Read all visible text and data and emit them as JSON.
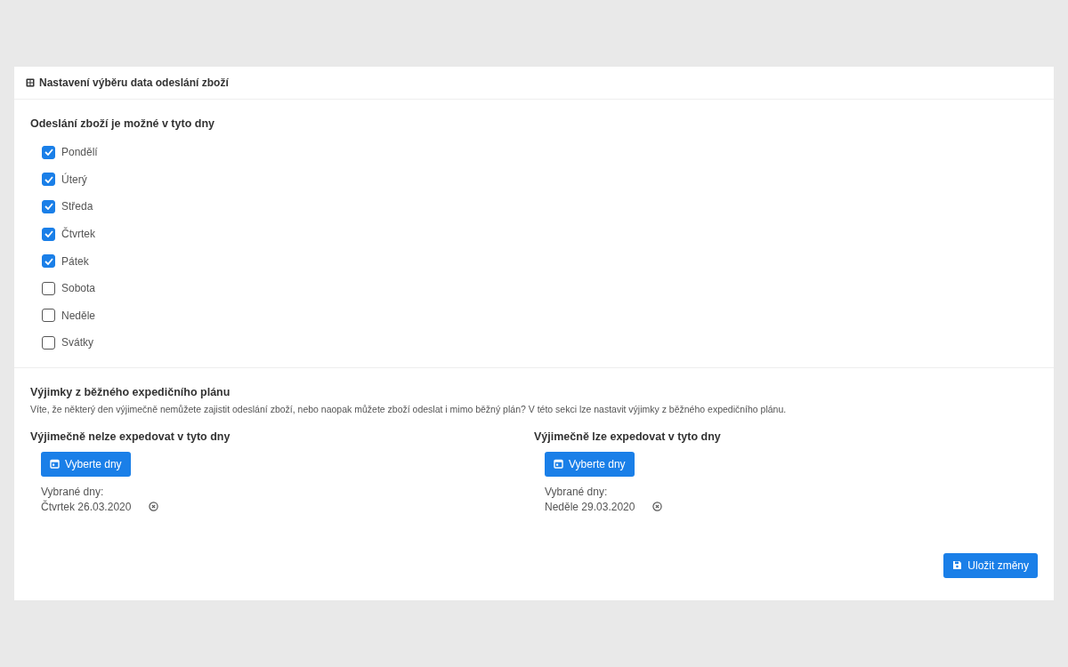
{
  "card": {
    "title": "Nastavení výběru data odeslání zboží"
  },
  "shipping_days": {
    "heading": "Odeslání zboží je možné v tyto dny",
    "days": [
      {
        "label": "Pondělí",
        "checked": true
      },
      {
        "label": "Úterý",
        "checked": true
      },
      {
        "label": "Středa",
        "checked": true
      },
      {
        "label": "Čtvrtek",
        "checked": true
      },
      {
        "label": "Pátek",
        "checked": true
      },
      {
        "label": "Sobota",
        "checked": false
      },
      {
        "label": "Neděle",
        "checked": false
      },
      {
        "label": "Svátky",
        "checked": false
      }
    ]
  },
  "exceptions": {
    "heading": "Výjimky z běžného expedičního plánu",
    "description": "Víte, že některý den výjimečně nemůžete zajistit odeslání zboží, nebo naopak můžete zboží odeslat i mimo běžný plán? V této sekci lze nastavit výjimky z běžného expedičního plánu.",
    "columns": [
      {
        "heading": "Výjimečně nelze expedovat v tyto dny",
        "button": "Vyberte dny",
        "selected_label": "Vybrané dny:",
        "dates": [
          "Čtvrtek 26.03.2020"
        ]
      },
      {
        "heading": "Výjimečně lze expedovat v tyto dny",
        "button": "Vyberte dny",
        "selected_label": "Vybrané dny:",
        "dates": [
          "Neděle 29.03.2020"
        ]
      }
    ]
  },
  "save_button": "Uložit změny"
}
